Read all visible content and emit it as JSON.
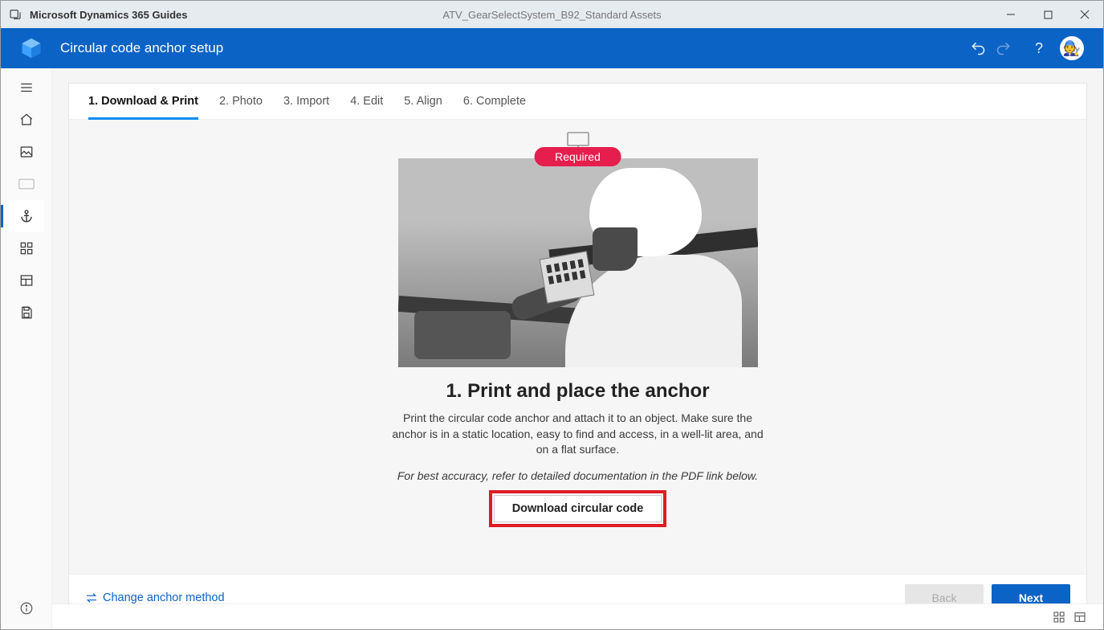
{
  "titlebar": {
    "app_name": "Microsoft Dynamics 365 Guides",
    "file_name": "ATV_GearSelectSystem_B92_Standard Assets"
  },
  "header": {
    "title": "Circular code anchor setup"
  },
  "tabs": [
    "1. Download & Print",
    "2. Photo",
    "3. Import",
    "4. Edit",
    "5. Align",
    "6. Complete"
  ],
  "content": {
    "required_label": "Required",
    "step_title": "1. Print and place the anchor",
    "step_desc": "Print the circular code anchor and attach it to an object. Make sure the anchor is in a static location, easy to find and access, in a well-lit area, and on a flat surface.",
    "step_note": "For best accuracy, refer to detailed documentation in the PDF link below.",
    "download_label": "Download circular code"
  },
  "footer": {
    "change_method": "Change anchor method",
    "back": "Back",
    "next": "Next"
  }
}
